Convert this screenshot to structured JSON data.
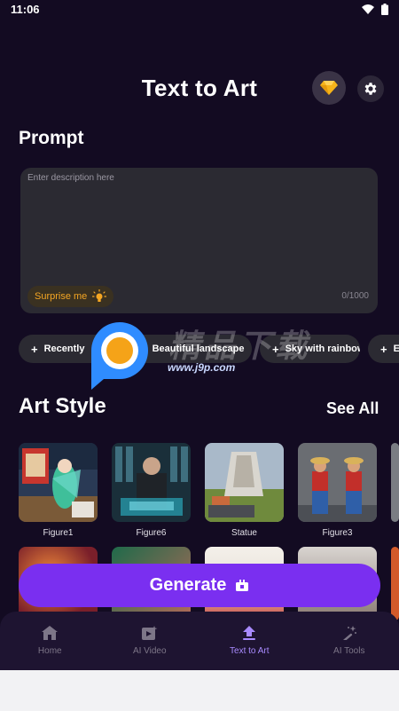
{
  "status_bar": {
    "time": "11:06"
  },
  "header": {
    "title": "Text to Art"
  },
  "prompt": {
    "heading": "Prompt",
    "placeholder": "Enter description here",
    "value": "",
    "surprise_label": "Surprise me",
    "counter": "0/1000"
  },
  "chips": [
    "Recently",
    "Beautiful landscape",
    "Sky with rainbow",
    "E"
  ],
  "watermark": {
    "cn_text": "精品下载",
    "url": "www.j9p.com"
  },
  "art_style": {
    "heading": "Art Style",
    "see_all": "See All",
    "items": [
      {
        "name": "Figure1"
      },
      {
        "name": "Figure6"
      },
      {
        "name": "Statue"
      },
      {
        "name": "Figure3"
      }
    ]
  },
  "generate": {
    "label": "Generate"
  },
  "nav": {
    "items": [
      {
        "label": "Home",
        "icon": "home-icon"
      },
      {
        "label": "AI Video",
        "icon": "video-icon"
      },
      {
        "label": "Text to Art",
        "icon": "art-icon"
      },
      {
        "label": "AI Tools",
        "icon": "magic-wand-icon"
      }
    ],
    "active": "Text to Art"
  },
  "colors": {
    "background": "#130b22",
    "accent": "#7a2ff0",
    "active_nav": "#a98bff",
    "surprise": "#f5a623"
  }
}
